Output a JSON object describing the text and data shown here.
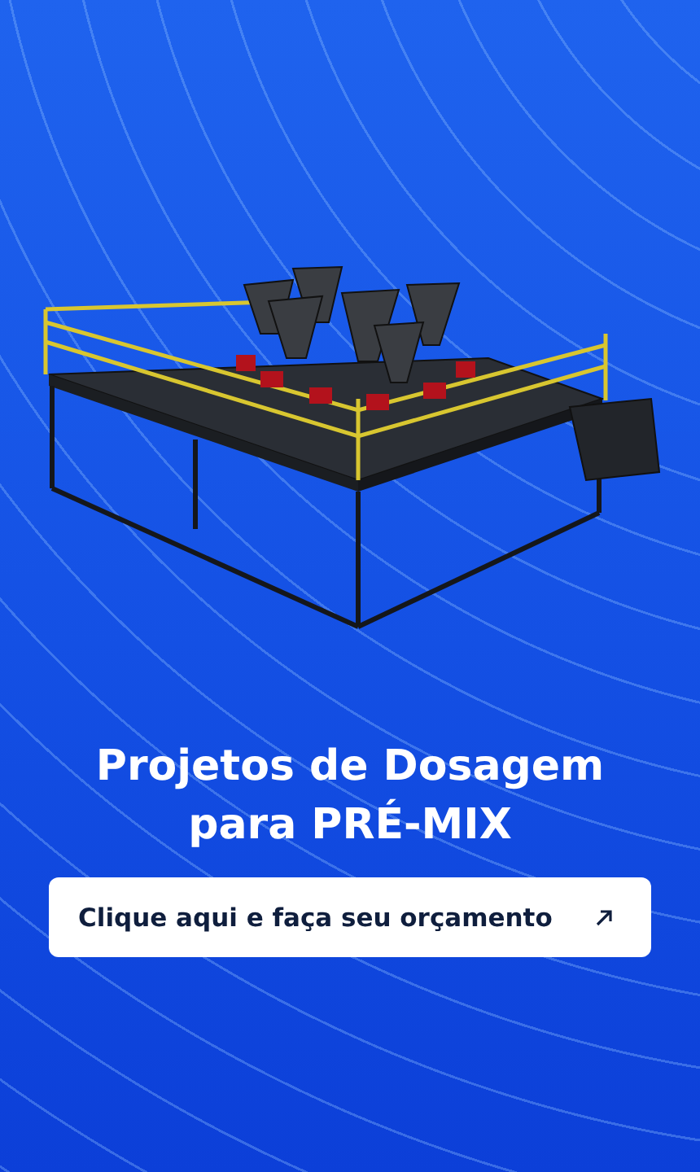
{
  "hero": {
    "title": "Projetos de Dosagem para PRÉ-MIX"
  },
  "cta": {
    "label": "Clique aqui e faça seu orçamento"
  }
}
